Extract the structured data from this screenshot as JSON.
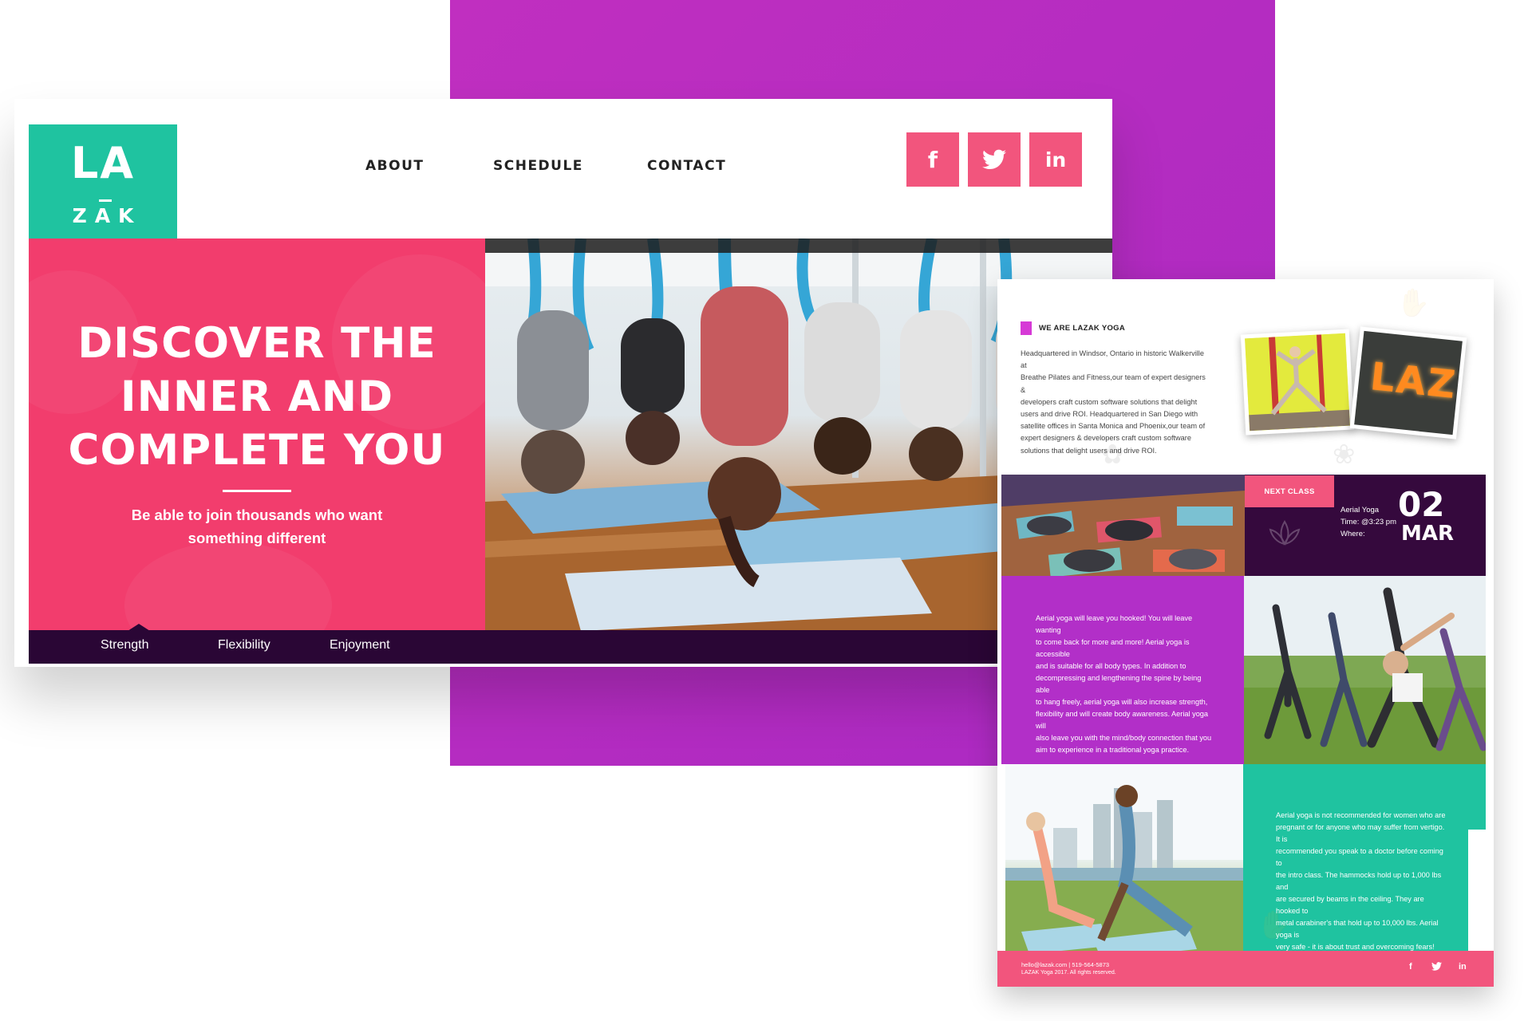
{
  "brand": {
    "logo_top": "LA",
    "logo_bottom": "ZAK",
    "accent": "#1fc3a0",
    "pink": "#f2557d",
    "purple": "#b22fc8",
    "dark": "#2a0635"
  },
  "nav": {
    "items": [
      {
        "label": "ABOUT"
      },
      {
        "label": "SCHEDULE"
      },
      {
        "label": "CONTACT"
      }
    ]
  },
  "social": [
    {
      "icon": "facebook-icon",
      "glyph": "f"
    },
    {
      "icon": "twitter-icon",
      "glyph": "🐦"
    },
    {
      "icon": "linkedin-icon",
      "glyph": "in"
    }
  ],
  "hero": {
    "title_lines": [
      "DISCOVER THE",
      "INNER AND",
      "COMPLETE YOU"
    ],
    "subtitle_lines": [
      "Be able to join thousands who want",
      "something different"
    ]
  },
  "tabs": [
    {
      "label": "Strength"
    },
    {
      "label": "Flexibility"
    },
    {
      "label": "Enjoyment"
    }
  ],
  "about": {
    "title": "WE ARE LAZAK YOGA",
    "body_lines": [
      "Headquartered in Windsor, Ontario in historic Walkerville at",
      "Breathe Pilates and Fitness,our team of expert designers &",
      "developers craft custom software solutions that delight",
      "users and drive ROI. Headquartered in San Diego with",
      "satellite offices in Santa Monica and Phoenix,our team of",
      "expert designers & developers craft custom software",
      "solutions that delight users and drive ROI."
    ]
  },
  "sign_text": "LAZ",
  "next_class": {
    "label": "NEXT CLASS",
    "name": "Aerial Yoga",
    "time": "Time: @3:23 pm",
    "where": "Where:",
    "day": "02",
    "month": "MAR"
  },
  "aerial_text_lines": [
    "Aerial yoga will leave you hooked! You will leave wanting",
    "to come back for more and more! Aerial yoga is accessible",
    "and is suitable for all body types. In addition to",
    "decompressing and lengthening the spine by being able",
    "to hang freely, aerial yoga will also increase strength,",
    "flexibility and will create body awareness. Aerial yoga will",
    "also leave you with the mind/body connection that you",
    "aim to experience in a traditional yoga practice."
  ],
  "warning_text_lines": [
    "Aerial yoga is not recommended for women who are",
    "pregnant or for anyone who may suffer from vertigo. It is",
    "recommended you speak to a doctor before coming to",
    "the intro class. The hammocks hold up to 1,000 lbs and",
    "are secured by beams in the ceiling. They are hooked to",
    "metal carabiner's that hold up to 10,000 lbs. Aerial yoga is",
    "very safe - it is about trust and overcoming fears!"
  ],
  "footer": {
    "contact": "hello@lazak.com   |   519-564-5873",
    "copyright": "LAZAK Yoga 2017. All rights reserved.",
    "social": [
      "f",
      "🐦",
      "in"
    ]
  }
}
